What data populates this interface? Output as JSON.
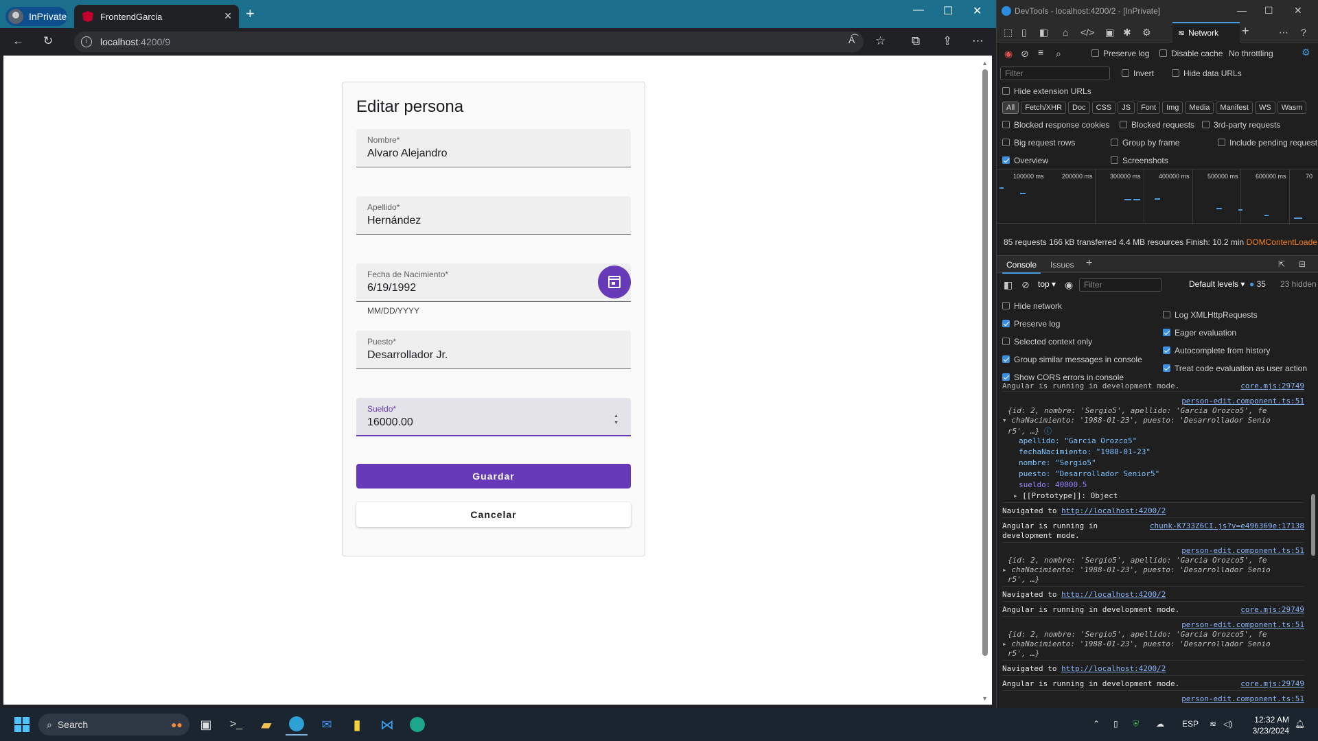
{
  "browser": {
    "profile_label": "InPrivate",
    "tab_title": "FrontendGarcia",
    "address_host": "localhost",
    "address_path": ":4200/9"
  },
  "form": {
    "title": "Editar persona",
    "fields": [
      {
        "label": "Nombre*",
        "value": "Alvaro Alejandro"
      },
      {
        "label": "Apellido*",
        "value": "Hernández"
      },
      {
        "label": "Fecha de Nacimiento*",
        "value": "6/19/1992",
        "hint": "MM/DD/YYYY"
      },
      {
        "label": "Puesto*",
        "value": "Desarrollador Jr."
      },
      {
        "label": "Sueldo*",
        "value": "16000.00"
      }
    ],
    "save_label": "Guardar",
    "cancel_label": "Cancelar"
  },
  "devtools": {
    "title": "DevTools - localhost:4200/2 - [InPrivate]",
    "active_panel": "Network",
    "preserve_log": "Preserve log",
    "disable_cache": "Disable cache",
    "throttling": "No throttling",
    "filter_placeholder": "Filter",
    "invert": "Invert",
    "hide_data_urls": "Hide data URLs",
    "hide_extension_urls": "Hide extension URLs",
    "type_filters": [
      "All",
      "Fetch/XHR",
      "Doc",
      "CSS",
      "JS",
      "Font",
      "Img",
      "Media",
      "Manifest",
      "WS",
      "Wasm"
    ],
    "blocked_response_cookies": "Blocked response cookies",
    "blocked_requests": "Blocked requests",
    "third_party": "3rd-party requests",
    "big_request_rows": "Big request rows",
    "group_by_frame": "Group by frame",
    "include_pending": "Include pending request",
    "overview": "Overview",
    "screenshots": "Screenshots",
    "timeline_ticks": [
      "100000 ms",
      "200000 ms",
      "300000 ms",
      "400000 ms",
      "500000 ms",
      "600000 ms",
      "70"
    ],
    "summary": {
      "requests": "85 requests",
      "transferred": "166 kB transferred",
      "resources": "4.4 MB resources",
      "finish": "Finish: 10.2 min",
      "dcl": "DOMContentLoade"
    },
    "drawer_tabs": [
      "Console",
      "Issues"
    ],
    "console": {
      "context": "top",
      "filter_placeholder": "Filter",
      "levels": "Default levels",
      "message_count": "35",
      "hidden": "23 hidden",
      "settings_left": [
        {
          "label": "Hide network",
          "checked": false
        },
        {
          "label": "Preserve log",
          "checked": true
        },
        {
          "label": "Selected context only",
          "checked": false
        },
        {
          "label": "Group similar messages in console",
          "checked": true
        },
        {
          "label": "Show CORS errors in console",
          "checked": true
        }
      ],
      "settings_right": [
        {
          "label": "Log XMLHttpRequests",
          "checked": false
        },
        {
          "label": "Eager evaluation",
          "checked": true
        },
        {
          "label": "Autocomplete from history",
          "checked": true
        },
        {
          "label": "Treat code evaluation as user action",
          "checked": true
        }
      ],
      "messages": {
        "top_cut": "Angular is running in development mode.",
        "top_cut_src": "core.mjs:29749",
        "src_person": "person-edit.component.ts:51",
        "obj_line1": "{id: 2, nombre: 'Sergio5', apellido: 'Garcia Orozco5', fe",
        "obj_line2": "chaNacimiento: '1988-01-23', puesto: 'Desarrollador Senio",
        "obj_line3": "r5', …}",
        "prop_apellido": "apellido: \"Garcia Orozco5\"",
        "prop_fecha": "fechaNacimiento: \"1988-01-23\"",
        "prop_nombre": "nombre: \"Sergio5\"",
        "prop_puesto": "puesto: \"Desarrollador Senior5\"",
        "prop_sueldo": "sueldo: 40000.5",
        "prop_proto": "[[Prototype]]: Object",
        "navigated_prefix": "Navigated to",
        "navigated_url": "http://localhost:4200/2",
        "angular_dev_1": "Angular is running in",
        "angular_dev_2": "development mode.",
        "chunk_src": "chunk-K733Z6CI.js?v=e496369e:17138",
        "angular_dev_full": "Angular is running in development mode.",
        "core_src": "core.mjs:29749"
      }
    }
  },
  "taskbar": {
    "search_label": "Search",
    "language": "ESP",
    "time": "12:32 AM",
    "date": "3/23/2024"
  },
  "colors": {
    "primary": "#673ab7",
    "tabbar": "#1b6f8c",
    "devtools_bg": "#1f1f1f",
    "accent_blue": "#4a9de0"
  }
}
